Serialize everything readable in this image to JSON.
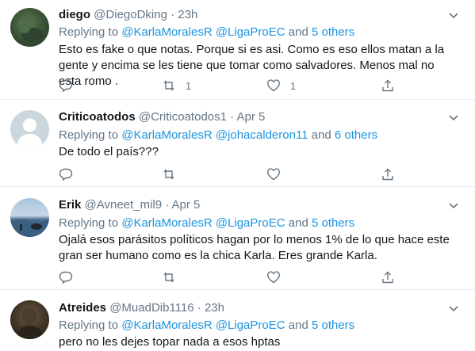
{
  "tweets": [
    {
      "name": "diego",
      "handle": "@DiegoDking",
      "dot": "·",
      "time": "23h",
      "replying_prefix": "Replying to ",
      "replying_users": "@KarlaMoralesR @LigaProEC",
      "replying_and": " and ",
      "replying_others": "5 others",
      "body": "Esto es fake o que notas. Porque si es asi. Como es eso ellos matan a la gente y encima se les tiene que tomar como salvadores. Menos mal no esta romo .",
      "reply_count": "",
      "retweet_count": "1",
      "like_count": "1"
    },
    {
      "name": "Criticoatodos",
      "handle": "@Criticoatodos1",
      "dot": "·",
      "time": "Apr 5",
      "replying_prefix": "Replying to ",
      "replying_users": "@KarlaMoralesR @johacalderon11",
      "replying_and": " and ",
      "replying_others": "6 others",
      "body": "De todo el país???",
      "reply_count": "",
      "retweet_count": "",
      "like_count": ""
    },
    {
      "name": "Erik",
      "handle": "@Avneet_mil9",
      "dot": "·",
      "time": "Apr 5",
      "replying_prefix": "Replying to ",
      "replying_users": "@KarlaMoralesR @LigaProEC",
      "replying_and": " and ",
      "replying_others": "5 others",
      "body": "Ojalá esos parásitos políticos hagan por lo menos 1% de lo que hace este gran ser humano como es la chica Karla. Eres grande Karla.",
      "reply_count": "",
      "retweet_count": "",
      "like_count": ""
    },
    {
      "name": "Atreides",
      "handle": "@MuadDib1116",
      "dot": "·",
      "time": "23h",
      "replying_prefix": "Replying to ",
      "replying_users": "@KarlaMoralesR @LigaProEC",
      "replying_and": " and ",
      "replying_others": "5 others",
      "body": "pero no les dejes topar nada a esos hptas",
      "reply_count": "",
      "retweet_count": "",
      "like_count": ""
    }
  ],
  "colors": {
    "text": "#14171a",
    "muted": "#657786",
    "link": "#1b95e0",
    "divider": "#e6ecf0"
  },
  "icons": [
    "chevron-down-icon",
    "reply-icon",
    "retweet-icon",
    "like-icon",
    "share-icon",
    "default-avatar-icon"
  ]
}
